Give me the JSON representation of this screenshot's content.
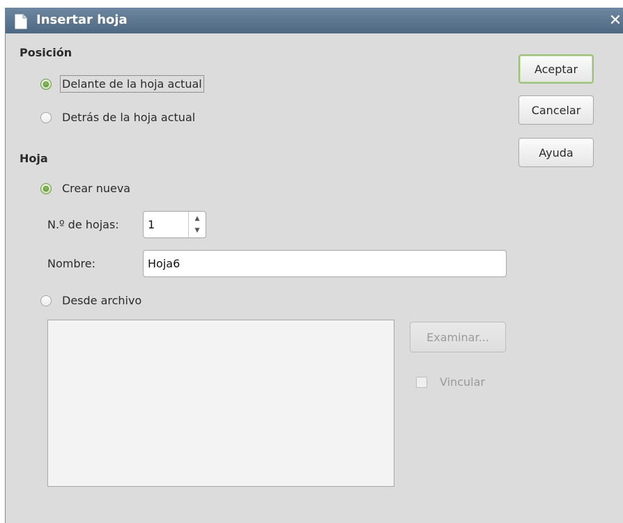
{
  "window": {
    "title": "Insertar hoja"
  },
  "position_section": {
    "heading": "Posición",
    "options": [
      {
        "label": "Delante de la hoja actual",
        "checked": true
      },
      {
        "label": "Detrás de la hoja actual",
        "checked": false
      }
    ]
  },
  "sheet_section": {
    "heading": "Hoja",
    "create_new": {
      "label": "Crear nueva",
      "checked": true
    },
    "count": {
      "label": "N.º de hojas:",
      "value": "1"
    },
    "name": {
      "label": "Nombre:",
      "value": "Hoja6"
    },
    "from_file": {
      "label": "Desde archivo",
      "checked": false
    },
    "browse_label": "Examinar...",
    "link_label": "Vincular"
  },
  "buttons": {
    "ok": "Aceptar",
    "cancel": "Cancelar",
    "help": "Ayuda"
  },
  "icons": {
    "title": "document-icon",
    "close": "close-icon"
  },
  "colors": {
    "titlebar": "#56708b",
    "dialog_bg": "#dcdcdc",
    "radio_checked": "#6da046"
  }
}
